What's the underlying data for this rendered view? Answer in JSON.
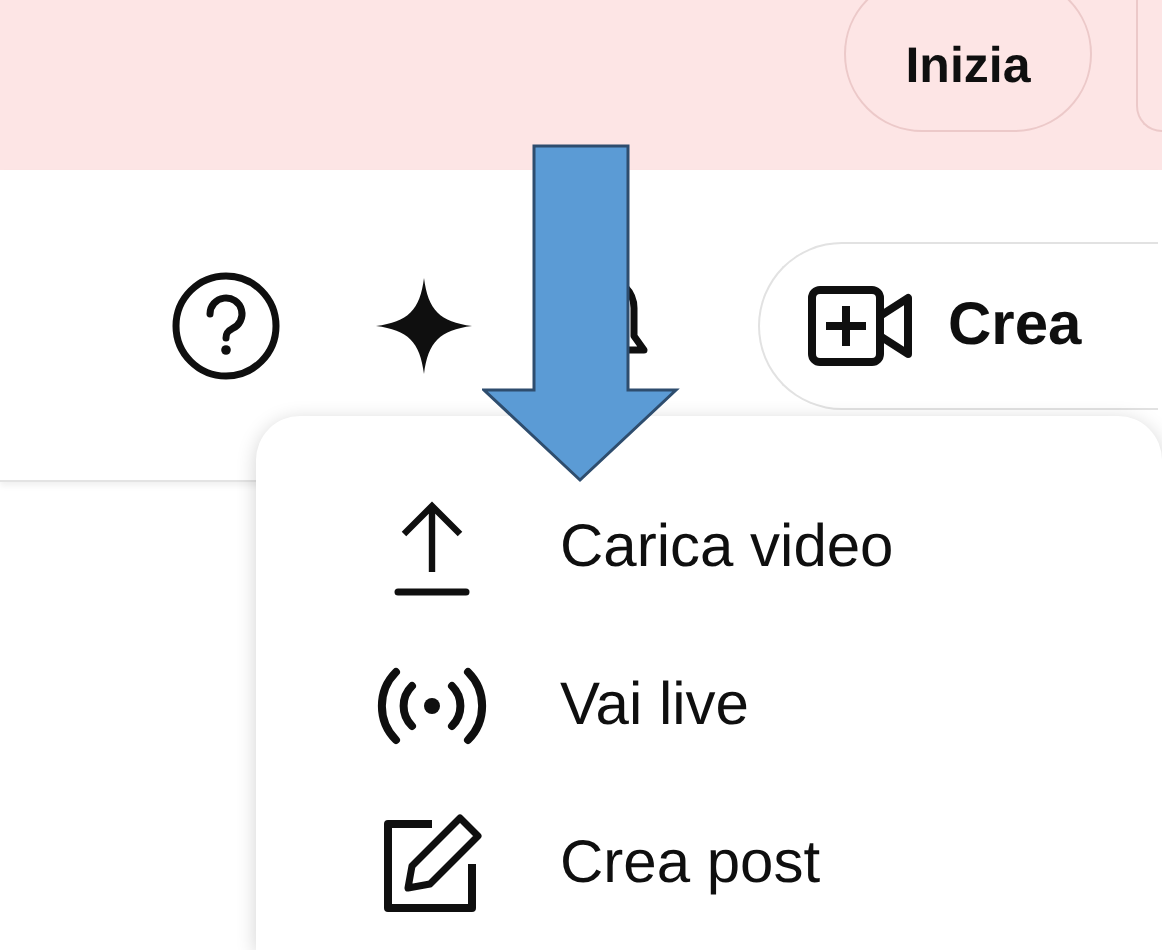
{
  "banner": {
    "button": "Inizia"
  },
  "header": {
    "create_button": "Crea"
  },
  "menu": {
    "items": [
      {
        "kind": "upload",
        "label": "Carica video"
      },
      {
        "kind": "live",
        "label": "Vai live"
      },
      {
        "kind": "post",
        "label": "Crea post"
      }
    ]
  }
}
